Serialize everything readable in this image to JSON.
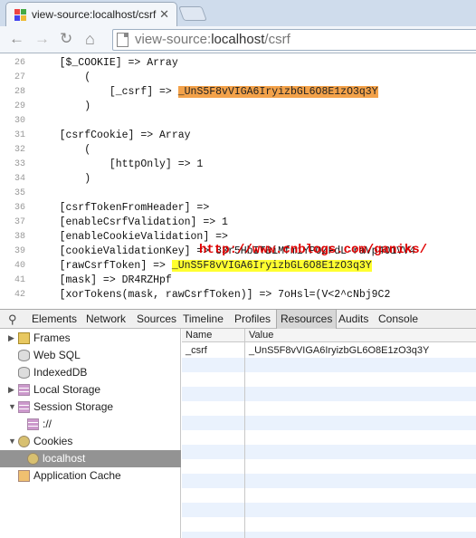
{
  "browser": {
    "tab_title": "view-source:localhost/csrf",
    "url_scheme": "view-source:",
    "url_host": "localhost",
    "url_path": "/csrf"
  },
  "source": {
    "lines": [
      {
        "num": "26",
        "pre": "    [$_COOKIE] => Array",
        "hl": "",
        "post": ""
      },
      {
        "num": "27",
        "pre": "        (",
        "hl": "",
        "post": ""
      },
      {
        "num": "28",
        "pre": "            [_csrf] => ",
        "hl": "_UnS5F8vVIGA6IryizbGL6O8E1zO3q3Y",
        "post": "",
        "hl_color": "orange"
      },
      {
        "num": "29",
        "pre": "        )",
        "hl": "",
        "post": ""
      },
      {
        "num": "30",
        "pre": "",
        "hl": "",
        "post": ""
      },
      {
        "num": "31",
        "pre": "    [csrfCookie] => Array",
        "hl": "",
        "post": ""
      },
      {
        "num": "32",
        "pre": "        (",
        "hl": "",
        "post": ""
      },
      {
        "num": "33",
        "pre": "            [httpOnly] => 1",
        "hl": "",
        "post": ""
      },
      {
        "num": "34",
        "pre": "        )",
        "hl": "",
        "post": ""
      },
      {
        "num": "35",
        "pre": "",
        "hl": "",
        "post": ""
      },
      {
        "num": "36",
        "pre": "    [csrfTokenFromHeader] =>",
        "hl": "",
        "post": ""
      },
      {
        "num": "37",
        "pre": "    [enableCsrfValidation] => 1",
        "hl": "",
        "post": ""
      },
      {
        "num": "38",
        "pre": "    [enableCookieValidation] =>",
        "hl": "",
        "post": ""
      },
      {
        "num": "39",
        "pre": "    [cookieValidationKey] => 83r5HbITBiMfmiYPOZFdL-raVp4O1VV4",
        "hl": "",
        "post": ""
      },
      {
        "num": "40",
        "pre": "    [rawCsrfToken] => ",
        "hl": "_UnS5F8vVIGA6IryizbGL6O8E1zO3q3Y",
        "post": "",
        "hl_color": "yellow"
      },
      {
        "num": "41",
        "pre": "    [mask] => DR4RZHpf",
        "hl": "",
        "post": ""
      },
      {
        "num": "42",
        "pre": "    [xorTokens(mask, rawCsrfToken)] => 7oHsl=(V<2^cNbj9C2",
        "hl": "",
        "post": ""
      }
    ],
    "watermark": "http://www.cnblogs.com/ganiks/"
  },
  "devtools": {
    "tabs": [
      "Elements",
      "Network",
      "Sources",
      "Timeline",
      "Profiles",
      "Resources",
      "Audits",
      "Console"
    ],
    "selected_tab": "Resources",
    "sidebar": [
      {
        "label": "Frames",
        "icon": "folder-icon",
        "expander": "collapsed",
        "indent": 0
      },
      {
        "label": "Web SQL",
        "icon": "database-icon",
        "expander": "",
        "indent": 0
      },
      {
        "label": "IndexedDB",
        "icon": "database-icon",
        "expander": "",
        "indent": 0
      },
      {
        "label": "Local Storage",
        "icon": "storage-grid-icon",
        "expander": "collapsed",
        "indent": 0
      },
      {
        "label": "Session Storage",
        "icon": "storage-grid-icon",
        "expander": "expanded",
        "indent": 0
      },
      {
        "label": "://",
        "icon": "storage-grid-icon",
        "expander": "",
        "indent": 1
      },
      {
        "label": "Cookies",
        "icon": "cookie-icon",
        "expander": "expanded",
        "indent": 0
      },
      {
        "label": "localhost",
        "icon": "cookie-icon",
        "expander": "",
        "indent": 1,
        "selected": true
      },
      {
        "label": "Application Cache",
        "icon": "app-cache-icon",
        "expander": "",
        "indent": 0
      }
    ],
    "table": {
      "columns": [
        "Name",
        "Value"
      ],
      "rows": [
        {
          "name": "_csrf",
          "value": "_UnS5F8vVIGA6IryizbGL6O8E1zO3q3Y"
        }
      ]
    }
  },
  "colors": {
    "highlight_orange": "#f3a24a",
    "highlight_yellow": "#ffff30",
    "watermark_red": "#e00000",
    "selected_sidebar": "#939393"
  }
}
